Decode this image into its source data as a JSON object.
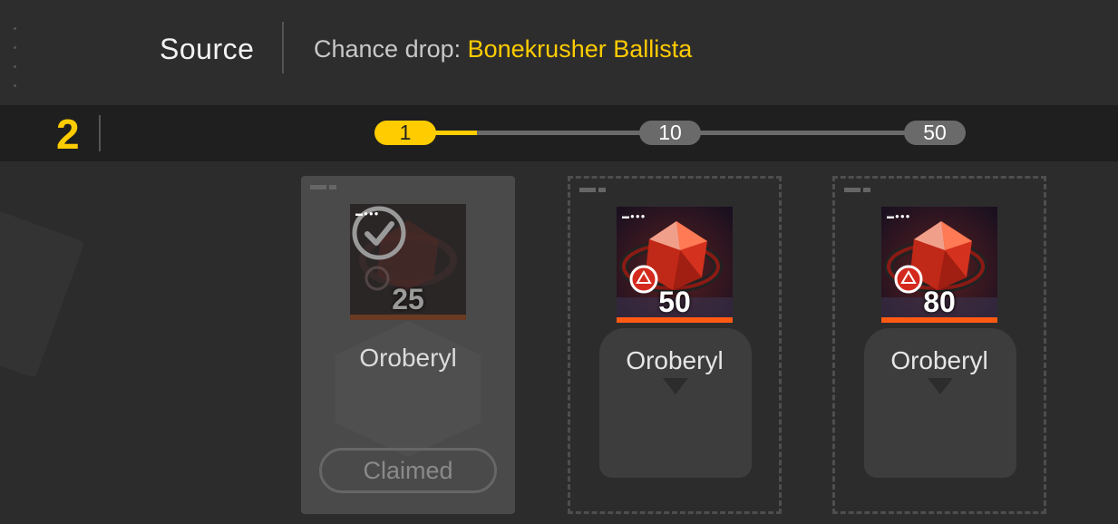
{
  "header": {
    "title": "Source",
    "chance_label": "Chance drop:",
    "chance_target": "Bonekrusher Ballista"
  },
  "progress": {
    "current_level": "2",
    "milestones": [
      "1",
      "10",
      "50"
    ],
    "active_milestone": "1"
  },
  "rewards": [
    {
      "name": "Oroberyl",
      "quantity": "25",
      "status": "claimed",
      "button_label": "Claimed"
    },
    {
      "name": "Oroberyl",
      "quantity": "50",
      "status": "locked"
    },
    {
      "name": "Oroberyl",
      "quantity": "80",
      "status": "locked"
    }
  ],
  "colors": {
    "accent": "#ffcc00",
    "rarity_bar": "#ff5a14",
    "background": "#2c2c2c"
  }
}
